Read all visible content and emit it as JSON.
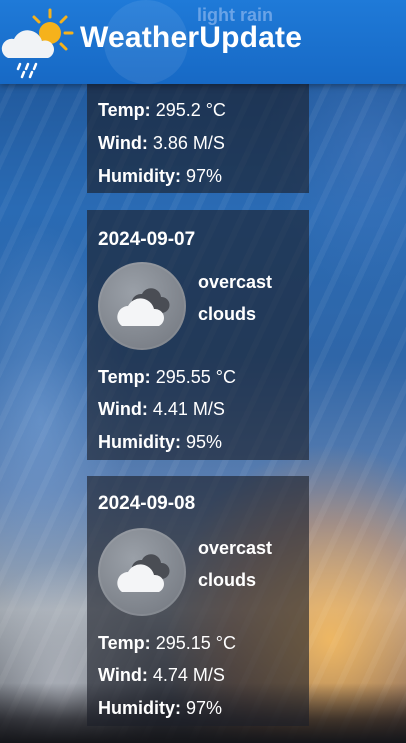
{
  "app": {
    "title": "WeatherUpdate",
    "logo_icon": "sun-cloud-rain-icon",
    "colors": {
      "header": "#1f7ad8",
      "card": "rgba(28,30,40,0.62)"
    }
  },
  "labels": {
    "temp": "Temp:",
    "wind": "Wind:",
    "humidity": "Humidity:"
  },
  "forecast": [
    {
      "date": "",
      "description": "light rain",
      "temp": "295.2 °C",
      "wind": "3.86 M/S",
      "humidity": "97%",
      "icon": "rain-cloud-icon"
    },
    {
      "date": "2024-09-07",
      "description_line1": "overcast",
      "description_line2": "clouds",
      "temp": "295.55 °C",
      "wind": "4.41 M/S",
      "humidity": "95%",
      "icon": "overcast-clouds-icon"
    },
    {
      "date": "2024-09-08",
      "description_line1": "overcast",
      "description_line2": "clouds",
      "temp": "295.15 °C",
      "wind": "4.74 M/S",
      "humidity": "97%",
      "icon": "overcast-clouds-icon"
    }
  ]
}
